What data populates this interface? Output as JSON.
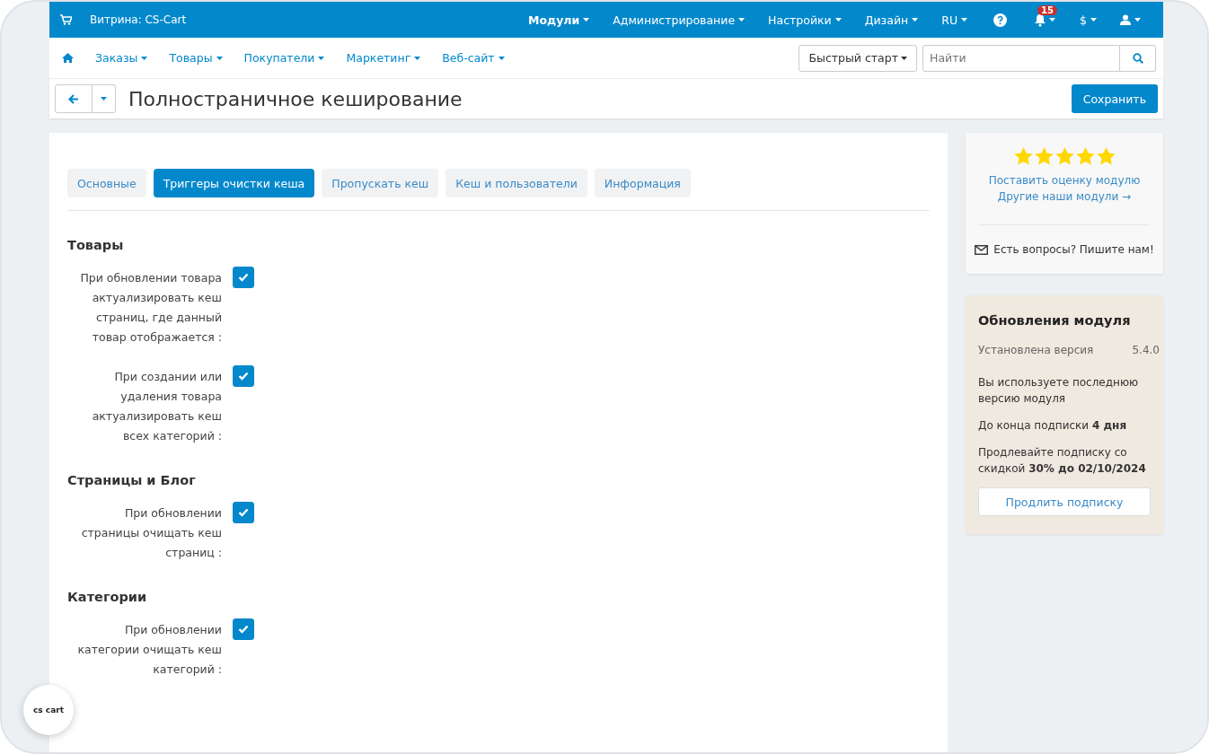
{
  "topbar": {
    "storefront": "Витрина: CS-Cart",
    "menus": [
      {
        "label": "Модули",
        "selected": true
      },
      {
        "label": "Администрирование",
        "selected": false
      },
      {
        "label": "Настройки",
        "selected": false
      },
      {
        "label": "Дизайн",
        "selected": false
      },
      {
        "label": "RU",
        "selected": false
      }
    ],
    "notifications_count": "15",
    "currency": "$"
  },
  "nav": {
    "menus": [
      "Заказы",
      "Товары",
      "Покупатели",
      "Маркетинг",
      "Веб-сайт"
    ],
    "quick_start": "Быстрый старт",
    "search": {
      "placeholder": "Найти"
    }
  },
  "page": {
    "title": "Полностраничное кеширование",
    "save": "Сохранить"
  },
  "tabs": [
    {
      "label": "Основные",
      "selected": false
    },
    {
      "label": "Триггеры очистки кеша",
      "selected": true
    },
    {
      "label": "Пропускать кеш",
      "selected": false
    },
    {
      "label": "Кеш и пользователи",
      "selected": false
    },
    {
      "label": "Информация",
      "selected": false
    }
  ],
  "sections": [
    {
      "title": "Товары",
      "options": [
        {
          "label": "При обновлении товара актуализировать кеш страниц, где данный товар отображается :",
          "checked": true
        },
        {
          "label": "При создании или удаления товара актуализировать кеш всех категорий :",
          "checked": true
        }
      ]
    },
    {
      "title": "Страницы и Блог",
      "options": [
        {
          "label": "При обновлении страницы очищать кеш страниц :",
          "checked": true
        }
      ]
    },
    {
      "title": "Категории",
      "options": [
        {
          "label": "При обновлении категории очищать кеш категорий :",
          "checked": true
        }
      ]
    }
  ],
  "rating": {
    "stars": 5,
    "rate_link": "Поставить оценку модулю",
    "other_link": "Другие наши модули →",
    "contact": "Есть вопросы? Пишите нам!"
  },
  "updates": {
    "title": "Обновления модуля",
    "version_label": "Установлена версия",
    "version": "5.4.0",
    "notes": [
      "Вы используете последнюю версию модуля",
      "До конца подписки **4 дня**",
      "Продлевайте подписку со скидкой **30% до 02/10/2024**"
    ],
    "button": "Продлить подписку"
  },
  "floating_logo": {
    "text": "cs cart"
  }
}
